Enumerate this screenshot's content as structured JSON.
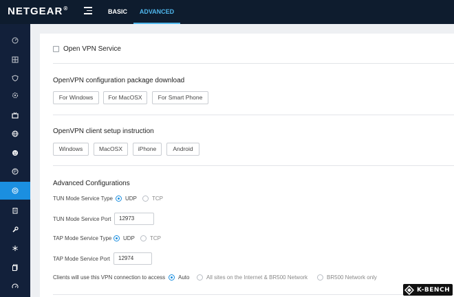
{
  "header": {
    "brand": "NETGEAR",
    "brand_mark": "®",
    "tabs": [
      {
        "label": "BASIC"
      },
      {
        "label": "ADVANCED"
      }
    ]
  },
  "sidebar": {
    "icons": [
      "dashboard-icon",
      "grid-icon",
      "shield-icon",
      "settings-icon",
      "tv-icon",
      "globe-icon",
      "smile-icon",
      "parental-icon",
      "vpn-icon",
      "clipboard-icon",
      "wrench-icon",
      "snowflake-icon",
      "document-icon",
      "speed-icon"
    ],
    "active_index": 8
  },
  "vpn": {
    "enable_label": "Open VPN Service",
    "enabled": false
  },
  "download": {
    "title": "OpenVPN configuration package download",
    "buttons": [
      "For Windows",
      "For MacOSX",
      "For Smart Phone"
    ]
  },
  "instructions": {
    "title": "OpenVPN client setup instruction",
    "buttons": [
      "Windows",
      "MacOSX",
      "iPhone",
      "Android"
    ]
  },
  "advanced": {
    "title": "Advanced Configurations",
    "tun_type_label": "TUN Mode Service Type",
    "tun_type_options": [
      "UDP",
      "TCP"
    ],
    "tun_type_selected": "UDP",
    "tun_port_label": "TUN Mode Service Port",
    "tun_port_value": "12973",
    "tap_type_label": "TAP Mode Service Type",
    "tap_type_options": [
      "UDP",
      "TCP"
    ],
    "tap_type_selected": "UDP",
    "tap_port_label": "TAP Mode Service Port",
    "tap_port_value": "12974",
    "access_label": "Clients will use this VPN connection to access",
    "access_options": [
      "Auto",
      "All sites on the Internet & BR500 Network",
      "BR500 Network only"
    ],
    "access_selected": "Auto"
  },
  "watermark": {
    "text": "K-BENCH"
  },
  "colors": {
    "topbar": "#0e1c2e",
    "sidebar": "#12203a",
    "accent": "#1b8fe0",
    "active_tab": "#4fb6ec"
  }
}
